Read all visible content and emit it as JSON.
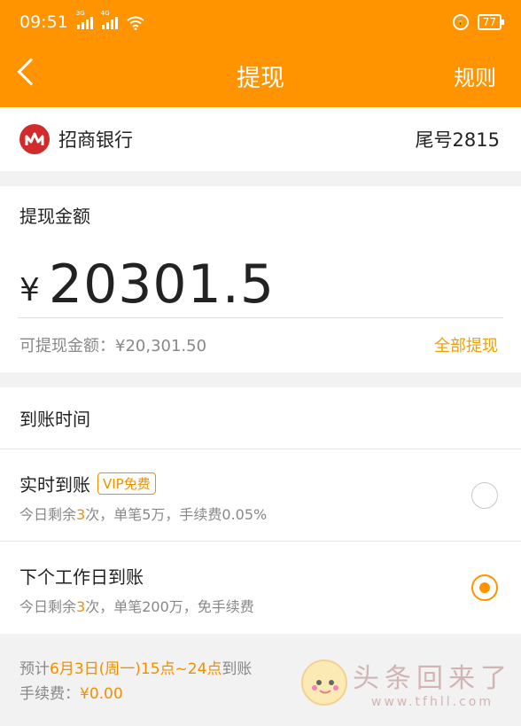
{
  "status_bar": {
    "time": "09:51",
    "net1": "3G",
    "net2": "4G",
    "battery": "77"
  },
  "nav": {
    "title": "提现",
    "rules": "规则"
  },
  "bank": {
    "name": "招商银行",
    "tail": "尾号2815"
  },
  "amount": {
    "label": "提现金额",
    "currency": "¥",
    "value": "20301.5",
    "available": "可提现金额：¥20,301.50",
    "withdraw_all": "全部提现"
  },
  "arrival": {
    "header": "到账时间",
    "options": [
      {
        "title": "实时到账",
        "badge": "VIP免费",
        "desc_pre": "今日剩余",
        "desc_count": "3",
        "desc_post": "次，单笔5万，手续费0.05%",
        "selected": false
      },
      {
        "title": "下个工作日到账",
        "desc_pre": "今日剩余",
        "desc_count": "3",
        "desc_post": "次，单笔200万，免手续费",
        "selected": true
      }
    ]
  },
  "footer": {
    "est_pre": "预计",
    "est_time": "6月3日(周一)15点~24点",
    "est_post": "到账",
    "fee_label": "手续费：",
    "fee_value": "¥0.00"
  },
  "watermark": {
    "text": "头条回来了",
    "url": "www.tfhll.com"
  },
  "colors": {
    "accent": "#ff9400",
    "highlight": "#f09000"
  }
}
